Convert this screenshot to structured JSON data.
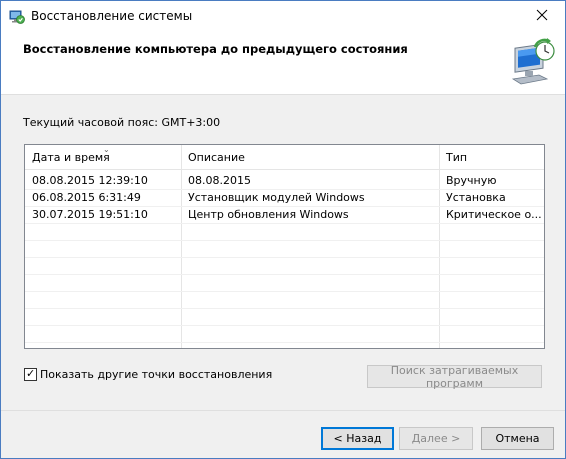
{
  "window": {
    "title": "Восстановление системы",
    "close_icon": "close-icon"
  },
  "header": {
    "title": "Восстановление компьютера до предыдущего состояния",
    "graphic_icon": "system-restore-monitor-icon"
  },
  "timezone_label": "Текущий часовой пояс: GMT+3:00",
  "list": {
    "columns": [
      "Дата и время",
      "Описание",
      "Тип"
    ],
    "rows": [
      {
        "date": "08.08.2015 12:39:10",
        "description": "08.08.2015",
        "type": "Вручную"
      },
      {
        "date": "06.08.2015 6:31:49",
        "description": "Установщик модулей Windows",
        "type": "Установка"
      },
      {
        "date": "30.07.2015 19:51:10",
        "description": "Центр обновления Windows",
        "type": "Критическое о..."
      }
    ]
  },
  "show_more_checkbox": {
    "label": "Показать другие точки восстановления",
    "checked": true
  },
  "buttons": {
    "scan": "Поиск затрагиваемых программ",
    "back": "< Назад",
    "next": "Далее >",
    "cancel": "Отмена"
  },
  "colors": {
    "accent": "#0078d7",
    "window_border": "#4a7cc1",
    "dialog_bg": "#f0f0f0"
  }
}
